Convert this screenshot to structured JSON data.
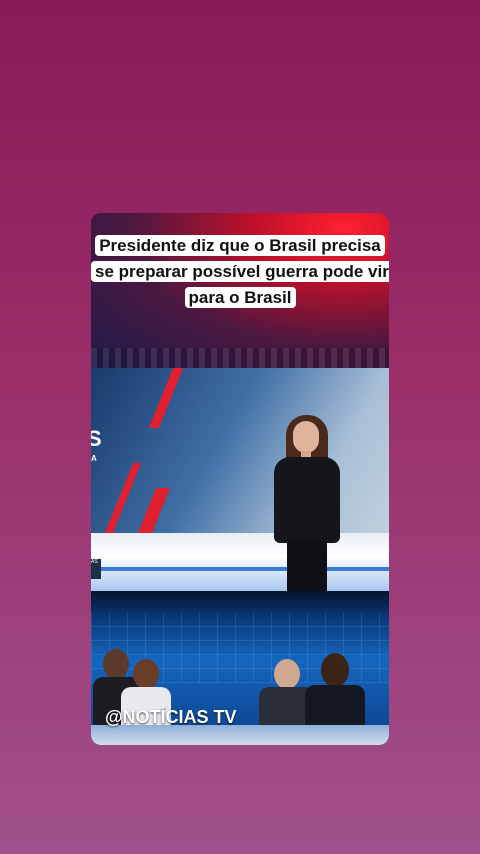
{
  "post": {
    "caption": "Presidente diz que o Brasil precisa se preparar possível guerra pode vir para o Brasil",
    "watermark": "@NOTÍCIAS TV"
  },
  "studio": {
    "logo_text": "S",
    "logo_sub": "A",
    "side_tag": "AS"
  },
  "colors": {
    "background_top": "#8a1a58",
    "background_bottom": "#a0508c",
    "accent_red": "#e0202e",
    "studio_blue": "#1566bf"
  }
}
